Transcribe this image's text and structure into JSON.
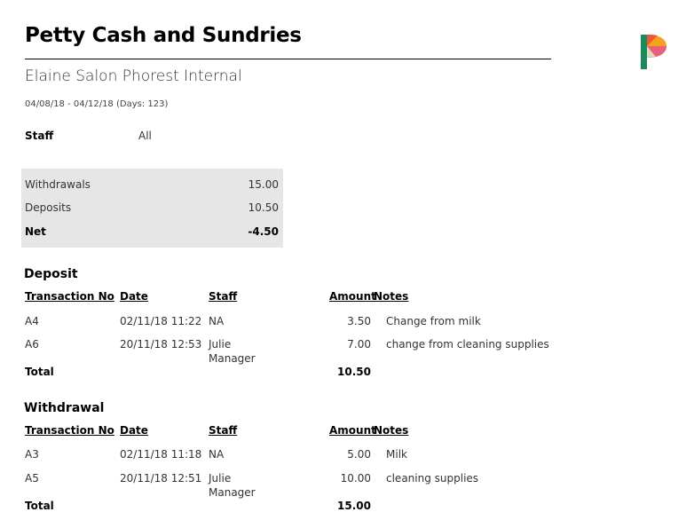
{
  "header": {
    "title": "Petty Cash and Sundries",
    "location": "Elaine Salon Phorest Internal",
    "date_range": "04/08/18 - 04/12/18 (Days: 123)"
  },
  "filter": {
    "staff_label": "Staff",
    "staff_value": "All"
  },
  "summary": {
    "rows": [
      {
        "label": "Withdrawals",
        "value": "15.00"
      },
      {
        "label": "Deposits",
        "value": "10.50"
      },
      {
        "label": "Net",
        "value": "-4.50"
      }
    ]
  },
  "columns": {
    "transaction_no": "Transaction No",
    "date": "Date",
    "staff": "Staff",
    "amount": "Amount",
    "notes": "Notes"
  },
  "deposit": {
    "title": "Deposit",
    "rows": [
      {
        "transaction_no": "A4",
        "date": "02/11/18 11:22",
        "staff_line1": "NA",
        "staff_line2": "",
        "amount": "3.50",
        "notes": "Change from milk"
      },
      {
        "transaction_no": "A6",
        "date": "20/11/18 12:53",
        "staff_line1": "Julie",
        "staff_line2": "Manager",
        "amount": "7.00",
        "notes": "change from cleaning supplies"
      }
    ],
    "total_label": "Total",
    "total_value": "10.50"
  },
  "withdrawal": {
    "title": "Withdrawal",
    "rows": [
      {
        "transaction_no": "A3",
        "date": "02/11/18 11:18",
        "staff_line1": "NA",
        "staff_line2": "",
        "amount": "5.00",
        "notes": "Milk"
      },
      {
        "transaction_no": "A5",
        "date": "20/11/18 12:51",
        "staff_line1": "Julie",
        "staff_line2": "Manager",
        "amount": "10.00",
        "notes": "cleaning supplies"
      }
    ],
    "total_label": "Total",
    "total_value": "15.00"
  },
  "brand": {
    "logo": "phorest-logo-icon",
    "colors": {
      "green": "#1a8a5a",
      "orange": "#f7a21b",
      "pink": "#e8607a",
      "red": "#e84c3d"
    }
  }
}
